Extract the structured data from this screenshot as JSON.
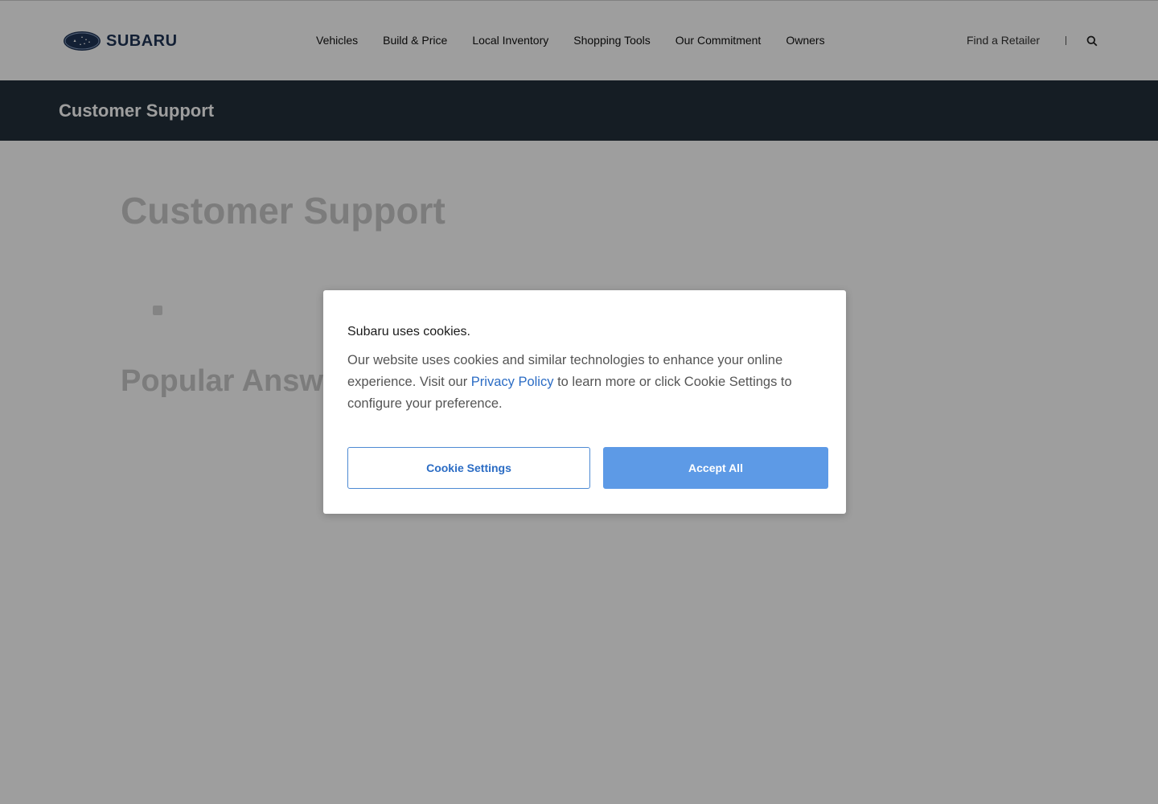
{
  "header": {
    "logo_text": "SUBARU",
    "nav_items": [
      {
        "label": "Vehicles"
      },
      {
        "label": "Build & Price"
      },
      {
        "label": "Local Inventory"
      },
      {
        "label": "Shopping Tools"
      },
      {
        "label": "Our Commitment"
      },
      {
        "label": "Owners"
      }
    ],
    "retailer_label": "Find a Retailer",
    "search_icon": "search-icon"
  },
  "band": {
    "title": "Customer Support"
  },
  "content": {
    "heading": "Customer Support",
    "popular_heading": "Popular Answe"
  },
  "cookie_dialog": {
    "title": "Subaru uses cookies.",
    "body_before": "Our website uses cookies and similar technologies to enhance your online experience. Visit our ",
    "link_text": "Privacy Policy",
    "body_after": " to learn more or click Cookie Settings to configure your preference.",
    "settings_label": "Cookie Settings",
    "accept_label": "Accept All"
  },
  "colors": {
    "band": "#222f3a",
    "accent": "#2b6cc4",
    "accept_button": "#5d9ae6"
  }
}
